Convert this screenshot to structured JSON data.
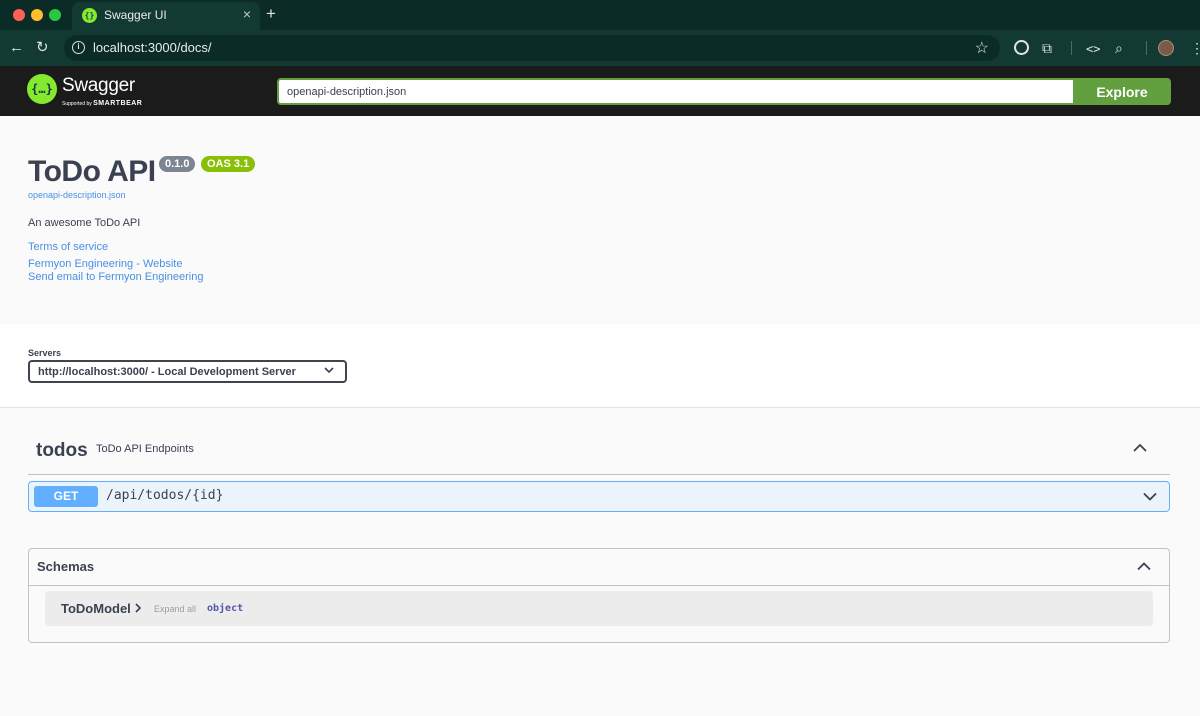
{
  "browser": {
    "tab_title": "Swagger UI",
    "tab_close": "×",
    "new_tab": "+",
    "url": "localhost:3000/docs/",
    "back": "←",
    "reload": "↻",
    "star": "☆",
    "info_glyph": "i",
    "ext_puzzle": "⧉",
    "ext_code": "<>",
    "ext_search": "⌕",
    "menu": "⋮",
    "favicon_glyph": "{}"
  },
  "topbar": {
    "brand": "Swagger",
    "supported_by": "Supported by",
    "vendor": "SMARTBEAR",
    "logo_glyph": "{…}",
    "spec_url": "openapi-description.json",
    "explore_label": "Explore"
  },
  "info": {
    "title": "ToDo API",
    "version": "0.1.0",
    "oas": "OAS 3.1",
    "spec_link": "openapi-description.json",
    "description": "An awesome ToDo API",
    "terms": "Terms of service",
    "website": "Fermyon Engineering - Website",
    "email": "Send email to Fermyon Engineering"
  },
  "servers": {
    "label": "Servers",
    "selected": "http://localhost:3000/ - Local Development Server"
  },
  "tag": {
    "name": "todos",
    "description": "ToDo API Endpoints"
  },
  "operations": [
    {
      "method": "GET",
      "path": "/api/todos/{id}"
    }
  ],
  "schemas": {
    "title": "Schemas",
    "models": [
      {
        "name": "ToDoModel",
        "expand": "Expand all",
        "type": "object"
      }
    ]
  },
  "colors": {
    "get": "#61affe",
    "explore": "#62a03f",
    "oas_badge": "#89bf04",
    "version_badge": "#7d8492"
  }
}
